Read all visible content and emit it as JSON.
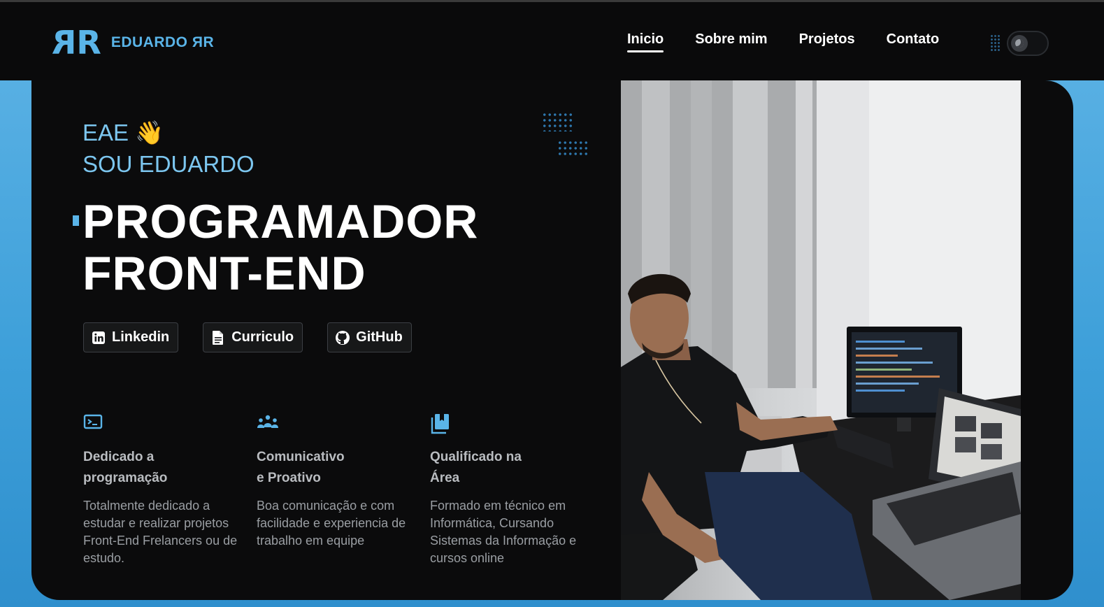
{
  "header": {
    "logo_mark": "RR",
    "logo_text": "EDUARDO ЯR",
    "nav": [
      {
        "label": "Inicio",
        "active": true
      },
      {
        "label": "Sobre mim",
        "active": false
      },
      {
        "label": "Projetos",
        "active": false
      },
      {
        "label": "Contato",
        "active": false
      }
    ],
    "theme_toggle_icon": "moon-icon"
  },
  "hero": {
    "greeting_line1": "EAE 👋",
    "greeting_line2": "SOU EDUARDO",
    "role_line1": "PROGRAMADOR",
    "role_line2": "FRONT-END",
    "buttons": [
      {
        "label": "Linkedin",
        "icon": "linkedin-icon"
      },
      {
        "label": "Curriculo",
        "icon": "document-icon"
      },
      {
        "label": "GitHub",
        "icon": "github-icon"
      }
    ]
  },
  "features": [
    {
      "icon": "terminal-icon",
      "title_line1": "Dedicado a",
      "title_line2": "programação",
      "text": "Totalmente dedicado a estudar e realizar projetos Front-End Frelancers ou de estudo."
    },
    {
      "icon": "team-icon",
      "title_line1": "Comunicativo",
      "title_line2": "e Proativo",
      "text": "Boa comunicação e com facilidade e experiencia de trabalho em equipe"
    },
    {
      "icon": "bookmark-book-icon",
      "title_line1": "Qualificado na",
      "title_line2": "Área",
      "text": "Formado em técnico em Informática, Cursando Sistemas da Informação e cursos online"
    }
  ],
  "colors": {
    "accent": "#5ab4e8",
    "page_background": "#3d9fd9",
    "card_background": "#0b0b0c"
  }
}
